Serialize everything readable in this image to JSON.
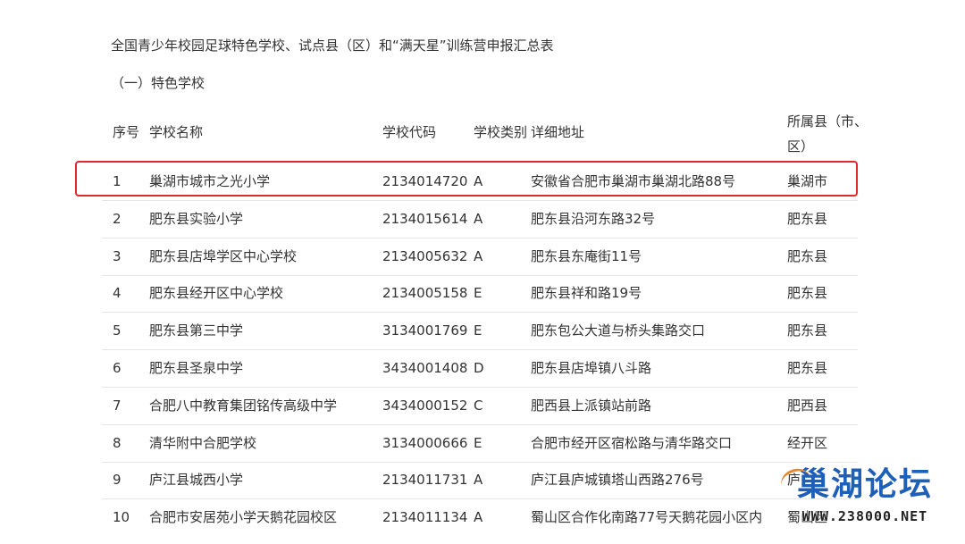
{
  "document": {
    "title": "全国青少年校园足球特色学校、试点县（区）和“满天星”训练营申报汇总表",
    "section": "（一）特色学校"
  },
  "table": {
    "headers": {
      "no": "序号",
      "name": "学校名称",
      "code": "学校代码",
      "type": "学校类别",
      "address": "详细地址",
      "county": "所属县（市、区）"
    },
    "rows": [
      {
        "no": "1",
        "name": "巢湖市城市之光小学",
        "code": "2134014720",
        "type": "A",
        "address": "安徽省合肥市巢湖市巢湖北路88号",
        "county": "巢湖市"
      },
      {
        "no": "2",
        "name": "肥东县实验小学",
        "code": "2134015614",
        "type": "A",
        "address": "肥东县沿河东路32号",
        "county": "肥东县"
      },
      {
        "no": "3",
        "name": "肥东县店埠学区中心学校",
        "code": "2134005632",
        "type": "A",
        "address": "肥东县东庵街11号",
        "county": "肥东县"
      },
      {
        "no": "4",
        "name": "肥东县经开区中心学校",
        "code": "2134005158",
        "type": "E",
        "address": "肥东县祥和路19号",
        "county": "肥东县"
      },
      {
        "no": "5",
        "name": "肥东县第三中学",
        "code": "3134001769",
        "type": "E",
        "address": "肥东包公大道与桥头集路交口",
        "county": "肥东县"
      },
      {
        "no": "6",
        "name": "肥东县圣泉中学",
        "code": "3434001408",
        "type": "D",
        "address": "肥东县店埠镇八斗路",
        "county": "肥东县"
      },
      {
        "no": "7",
        "name": "合肥八中教育集团铭传高级中学",
        "code": "3434000152",
        "type": "C",
        "address": "肥西县上派镇站前路",
        "county": "肥西县"
      },
      {
        "no": "8",
        "name": "清华附中合肥学校",
        "code": "3134000666",
        "type": "E",
        "address": "合肥市经开区宿松路与清华路交口",
        "county": "经开区"
      },
      {
        "no": "9",
        "name": "庐江县城西小学",
        "code": "2134011731",
        "type": "A",
        "address": "庐江县庐城镇塔山西路276号",
        "county": "庐"
      },
      {
        "no": "10",
        "name": "合肥市安居苑小学天鹅花园校区",
        "code": "2134011134",
        "type": "A",
        "address": "蜀山区合作化南路77号天鹅花园小区内",
        "county": "蜀山区"
      }
    ]
  },
  "watermark": {
    "title": "巢湖论坛",
    "url": "WWW.238000.NET"
  },
  "colors": {
    "highlight": "#e02a2a",
    "watermark_blue": "#1e5fb8",
    "text": "#333333"
  }
}
